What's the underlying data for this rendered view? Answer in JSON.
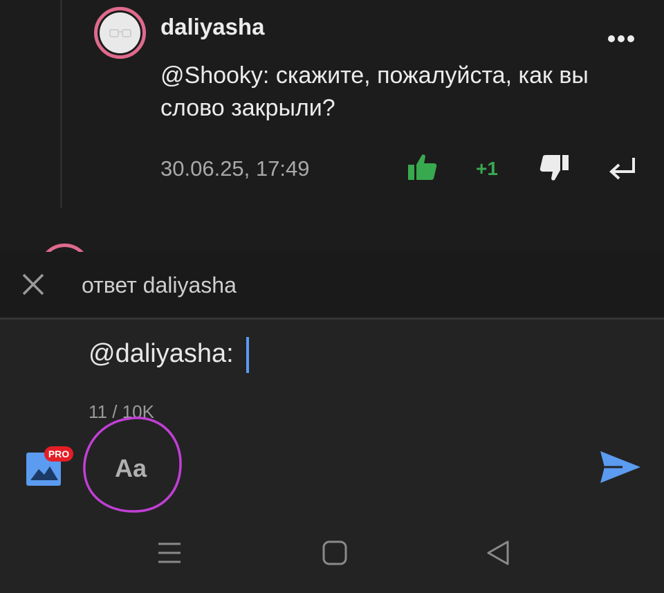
{
  "comment": {
    "username": "daliyasha",
    "text": "@Shooky: скажите, пожалуйста, как вы слово закрыли?",
    "timestamp": "30.06.25, 17:49",
    "score": "+1"
  },
  "reply_bar": {
    "label": "ответ daliyasha"
  },
  "composer": {
    "input_value": "@daliyasha:",
    "char_count": "11 / 10K",
    "pro_badge": "PRO",
    "format_button_label": "Aa"
  },
  "icons": {
    "more": "more-horizontal-icon",
    "like": "thumbs-up-icon",
    "dislike": "thumbs-down-icon",
    "reply": "reply-arrow-icon",
    "close": "close-icon",
    "image": "image-icon",
    "send": "send-icon",
    "nav_menu": "menu-icon",
    "nav_home": "home-icon",
    "nav_back": "back-icon"
  },
  "colors": {
    "background": "#1c1c1c",
    "composer_background": "#232323",
    "accent_like": "#39a94f",
    "accent_send": "#5b9bf0",
    "avatar_ring": "#e06a8d",
    "pro_badge": "#e41e26",
    "annotation_circle": "#c23fd6"
  }
}
